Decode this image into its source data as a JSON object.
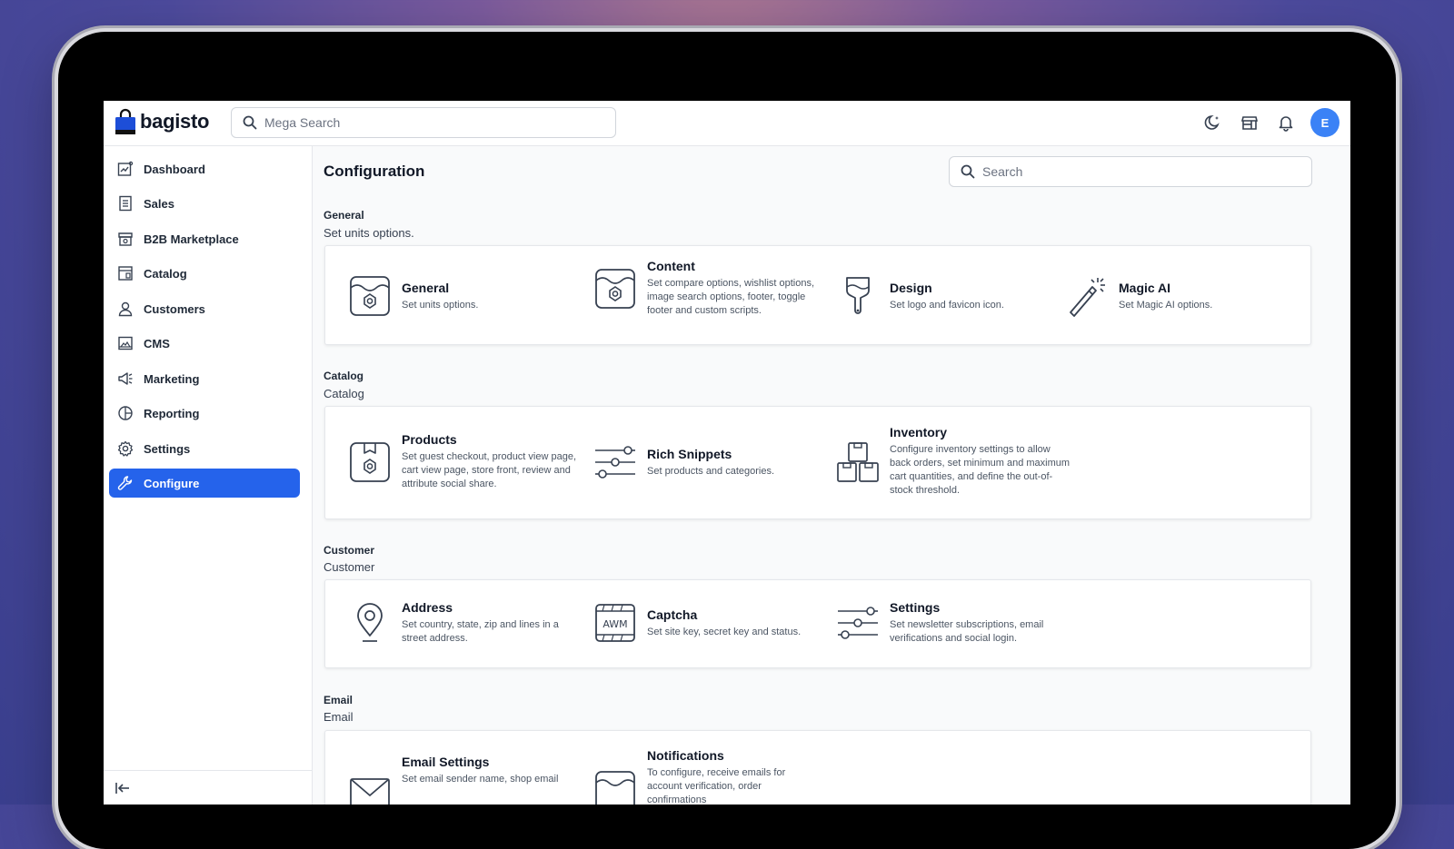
{
  "header": {
    "logo_text": "bagisto",
    "mega_search_placeholder": "Mega Search",
    "avatar_initial": "E"
  },
  "sidebar": {
    "items": [
      {
        "label": "Dashboard",
        "icon": "dashboard-icon"
      },
      {
        "label": "Sales",
        "icon": "sales-icon"
      },
      {
        "label": "B2B Marketplace",
        "icon": "marketplace-icon"
      },
      {
        "label": "Catalog",
        "icon": "catalog-icon"
      },
      {
        "label": "Customers",
        "icon": "customers-icon"
      },
      {
        "label": "CMS",
        "icon": "cms-icon"
      },
      {
        "label": "Marketing",
        "icon": "marketing-icon"
      },
      {
        "label": "Reporting",
        "icon": "reporting-icon"
      },
      {
        "label": "Settings",
        "icon": "settings-icon"
      },
      {
        "label": "Configure",
        "icon": "configure-icon",
        "active": true
      }
    ]
  },
  "main": {
    "title": "Configuration",
    "search_placeholder": "Search",
    "sections": [
      {
        "title": "General",
        "description": "Set units options.",
        "items": [
          {
            "title": "General",
            "desc": "Set units options.",
            "icon": "general-icon"
          },
          {
            "title": "Content",
            "desc": "Set compare options, wishlist options, image search options, footer, toggle footer and custom scripts.",
            "icon": "content-icon"
          },
          {
            "title": "Design",
            "desc": "Set logo and favicon icon.",
            "icon": "design-icon"
          },
          {
            "title": "Magic AI",
            "desc": "Set Magic AI options.",
            "icon": "magic-ai-icon"
          }
        ]
      },
      {
        "title": "Catalog",
        "description": "Catalog",
        "items": [
          {
            "title": "Products",
            "desc": "Set guest checkout, product view page, cart view page, store front, review and attribute social share.",
            "icon": "products-icon"
          },
          {
            "title": "Rich Snippets",
            "desc": "Set products and categories.",
            "icon": "rich-snippets-icon"
          },
          {
            "title": "Inventory",
            "desc": "Configure inventory settings to allow back orders, set minimum and maximum cart quantities, and define the out-of-stock threshold.",
            "icon": "inventory-icon"
          }
        ]
      },
      {
        "title": "Customer",
        "description": "Customer",
        "items": [
          {
            "title": "Address",
            "desc": "Set country, state, zip and lines in a street address.",
            "icon": "address-icon"
          },
          {
            "title": "Captcha",
            "desc": "Set site key, secret key and status.",
            "icon": "captcha-icon"
          },
          {
            "title": "Settings",
            "desc": "Set newsletter subscriptions, email verifications and social login.",
            "icon": "customer-settings-icon"
          }
        ]
      },
      {
        "title": "Email",
        "description": "Email",
        "items": [
          {
            "title": "Email Settings",
            "desc": "Set email sender name, shop email",
            "icon": "email-settings-icon"
          },
          {
            "title": "Notifications",
            "desc": "To configure, receive emails for account verification, order confirmations",
            "icon": "notifications-icon"
          }
        ]
      }
    ]
  },
  "colors": {
    "accent": "#2563eb",
    "avatar": "#3b82f6"
  }
}
